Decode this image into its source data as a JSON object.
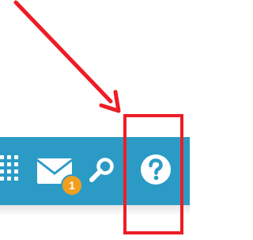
{
  "toolbar": {
    "color": "#2b9bc6",
    "icons": [
      "apps-grid-icon",
      "mail-icon",
      "search-icon",
      "help-icon"
    ],
    "mail": {
      "badge_count": "1",
      "badge_color": "#f0a01e"
    }
  },
  "annotation": {
    "color": "#ee1c25",
    "shapes": [
      "arrow",
      "rectangle"
    ],
    "target": "help-icon"
  }
}
